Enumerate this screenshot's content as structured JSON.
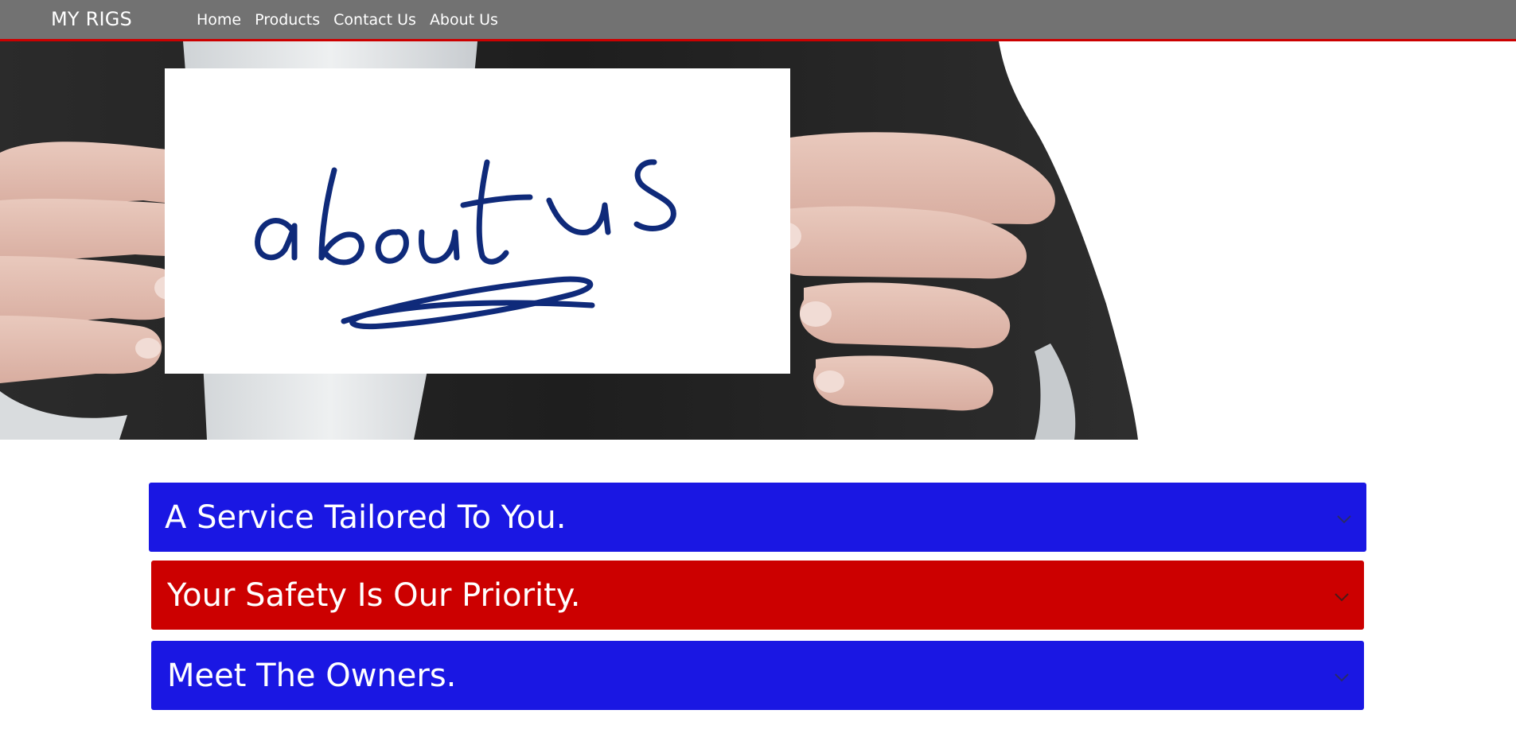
{
  "navbar": {
    "brand": "MY RIGS",
    "links": [
      {
        "label": "Home"
      },
      {
        "label": "Products"
      },
      {
        "label": "Contact Us"
      },
      {
        "label": "About Us"
      }
    ]
  },
  "hero": {
    "image_icon": "about-us-card-photo",
    "card_text": "about us"
  },
  "accordion": {
    "items": [
      {
        "label": "A Service Tailored To You.",
        "color": "#1a17e3",
        "icon": "chevron-down-icon"
      },
      {
        "label": "Your Safety Is Our Priority.",
        "color": "#cc0000",
        "icon": "chevron-down-icon"
      },
      {
        "label": "Meet The Owners.",
        "color": "#1a17e3",
        "icon": "chevron-down-icon"
      }
    ]
  },
  "colors": {
    "navbar_bg": "#727272",
    "navbar_border": "#cc0000",
    "accent_blue": "#1a17e3",
    "accent_red": "#cc0000",
    "ink_blue": "#0f2a7a"
  }
}
